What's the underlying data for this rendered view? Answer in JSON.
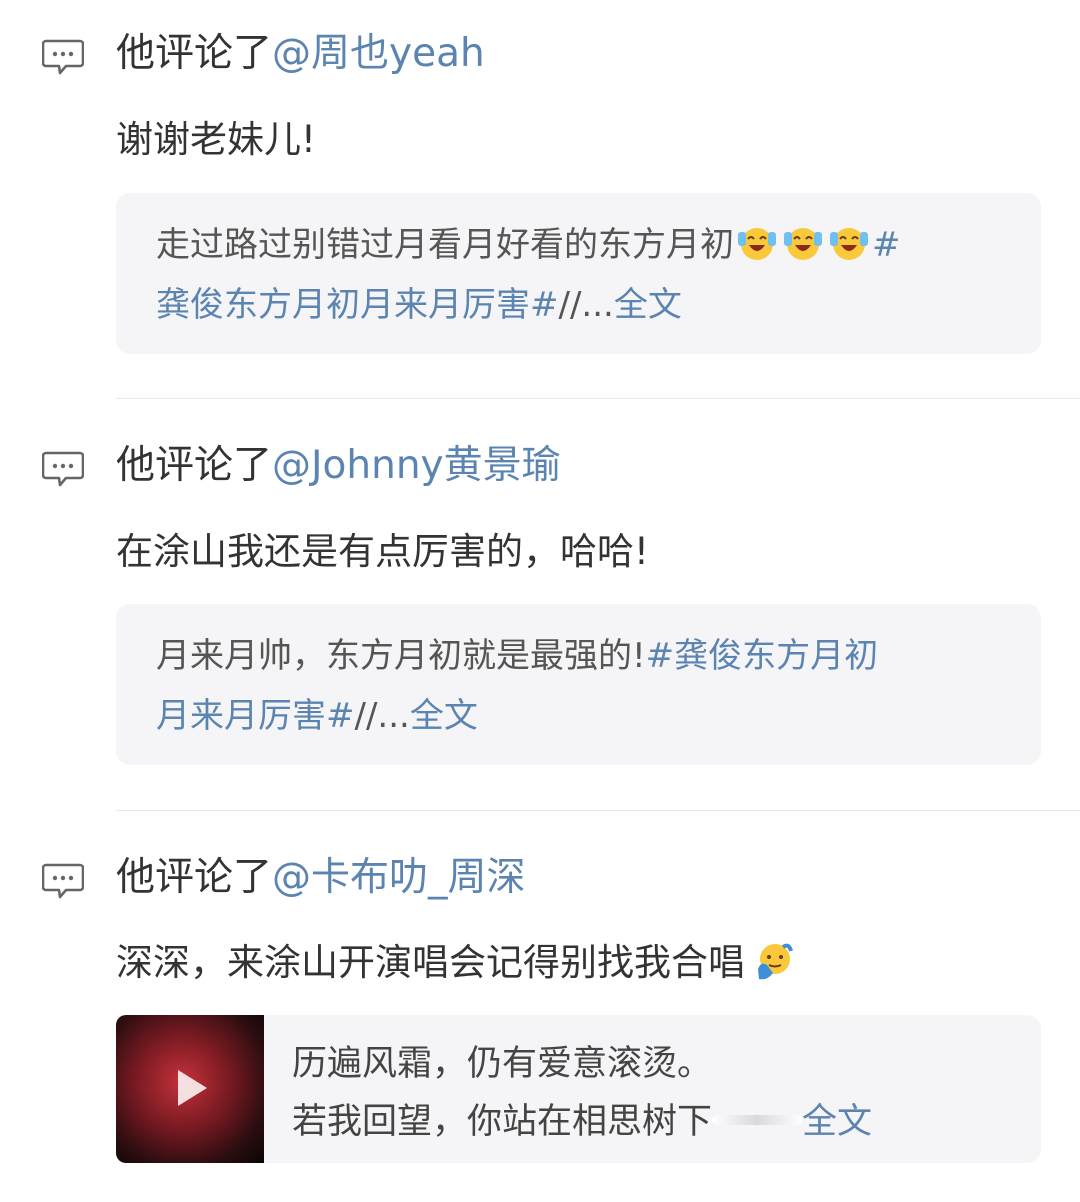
{
  "comments": [
    {
      "prefix": "他评论了",
      "mention": "@周也yeah",
      "reply": "谢谢老妹儿!",
      "quote_line1": "走过路过别错过月看月好看的东方月初",
      "quote_line1_tag": "#",
      "quote_line2_tag": "龚俊东方月初月来月厉害#",
      "quote_line2_suffix": "//...",
      "more": "全文"
    },
    {
      "prefix": "他评论了",
      "mention": "@Johnny黄景瑜",
      "reply": "在涂山我还是有点厉害的，哈哈!",
      "quote_line1": "月来月帅，东方月初就是最强的!",
      "quote_line1_tag": "#龚俊东方月初",
      "quote_line2_tag": "月来月厉害#",
      "quote_line2_suffix": "//...",
      "more": "全文"
    },
    {
      "prefix": "他评论了",
      "mention": "@卡布叻_周深",
      "reply": "深深，来涂山开演唱会记得别找我合唱",
      "video_line1": "历遍风霜，仍有爱意滚烫。",
      "video_line2": "若我回望，你站在相思树下",
      "more": "全文"
    }
  ],
  "icons": {
    "comment": "comment-bubble-icon",
    "laugh_emoji": "laugh-cry-emoji-icon",
    "facepalm_emoji": "awkward-emoji-icon",
    "play": "play-icon"
  },
  "colors": {
    "link": "#5b84b1",
    "quote_bg": "#f5f5f7"
  }
}
